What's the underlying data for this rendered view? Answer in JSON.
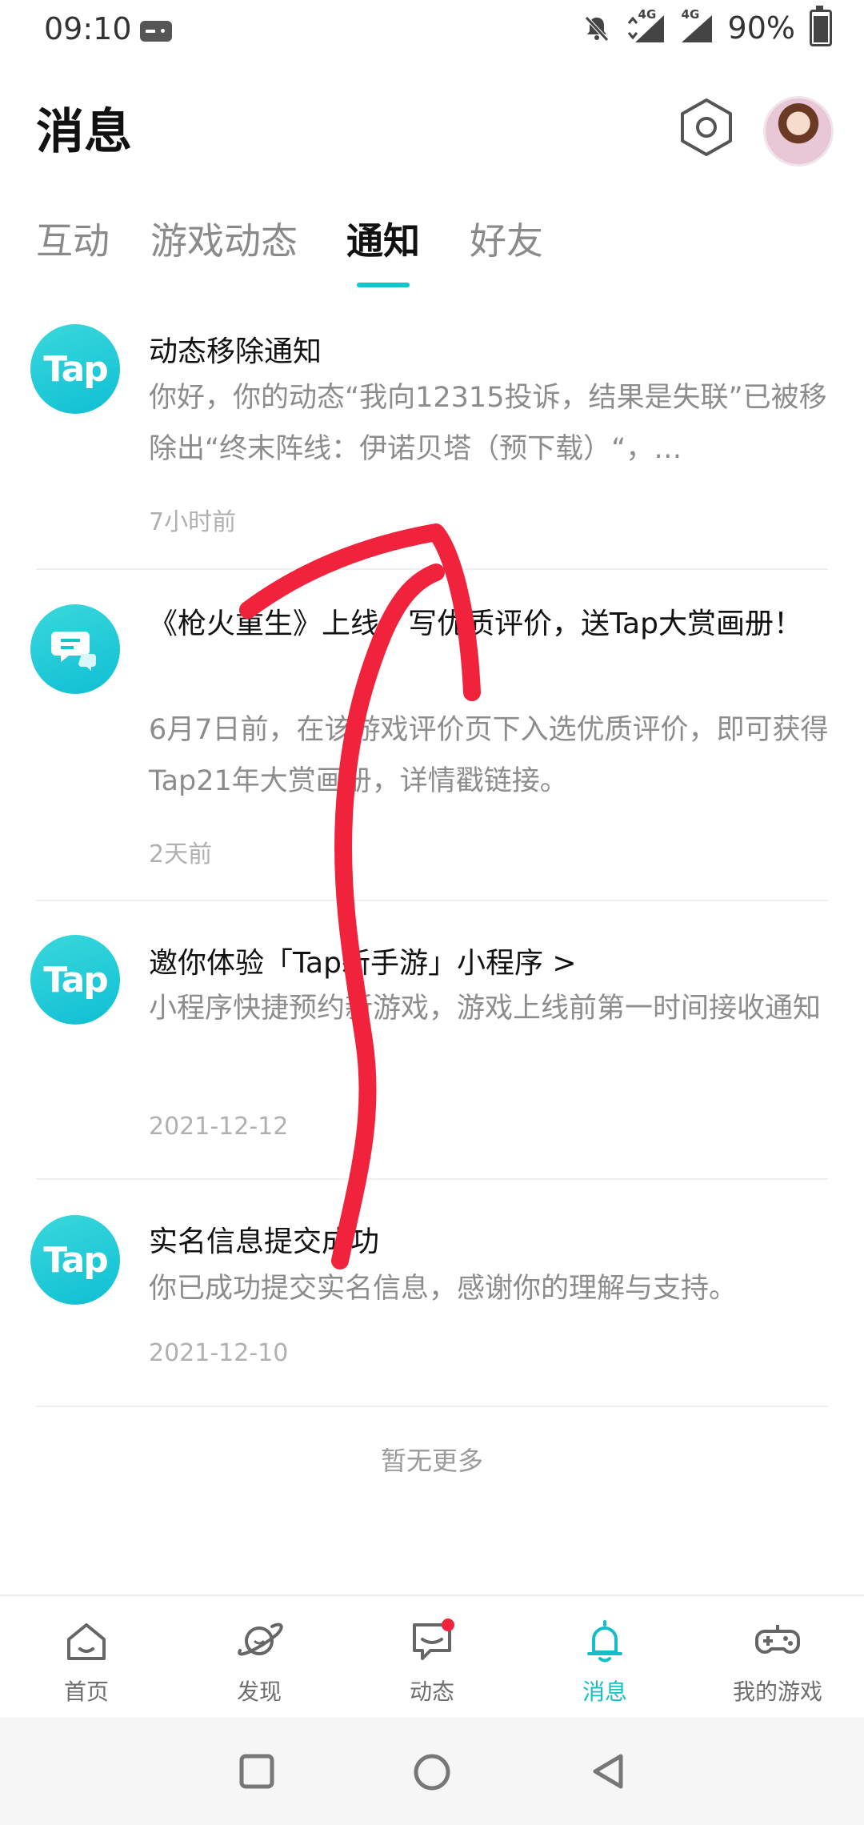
{
  "status_bar": {
    "time": "09:10",
    "network_1": "4G",
    "network_2": "4G",
    "battery": "90%"
  },
  "header": {
    "title": "消息"
  },
  "tabs": [
    {
      "label": "互动",
      "active": false
    },
    {
      "label": "游戏动态",
      "active": false
    },
    {
      "label": "通知",
      "active": true
    },
    {
      "label": "好友",
      "active": false
    }
  ],
  "notifications": [
    {
      "icon": "tap-logo",
      "icon_text": "Tap",
      "title": "动态移除通知",
      "body": "你好，你的动态“我向12315投诉，结果是失联”已被移除出“终末阵线：伊诺贝塔（预下载）“，…",
      "time": "7小时前"
    },
    {
      "icon": "chat-bubble-icon",
      "title": "《枪火重生》上线，写优质评价，送Tap大赏画册！",
      "body": "6月7日前，在该游戏评价页下入选优质评价，即可获得Tap21年大赏画册，详情戳链接。",
      "time": "2天前"
    },
    {
      "icon": "tap-logo",
      "icon_text": "Tap",
      "title": "邀你体验「Tap新手游」小程序 >",
      "body": "小程序快捷预约新游戏，游戏上线前第一时间接收通知",
      "time": "2021-12-12"
    },
    {
      "icon": "tap-logo",
      "icon_text": "Tap",
      "title": "实名信息提交成功",
      "body": "你已成功提交实名信息，感谢你的理解与支持。",
      "time": "2021-12-10"
    }
  ],
  "footer": {
    "no_more": "暂无更多"
  },
  "bottom_nav": [
    {
      "label": "首页",
      "icon": "home-icon",
      "active": false
    },
    {
      "label": "发现",
      "icon": "planet-icon",
      "active": false
    },
    {
      "label": "动态",
      "icon": "message-icon",
      "active": false,
      "badge": true
    },
    {
      "label": "消息",
      "icon": "bell-icon",
      "active": true
    },
    {
      "label": "我的游戏",
      "icon": "gamepad-icon",
      "active": false
    }
  ],
  "colors": {
    "accent": "#14bfc9",
    "annotation": "#f0223c"
  }
}
